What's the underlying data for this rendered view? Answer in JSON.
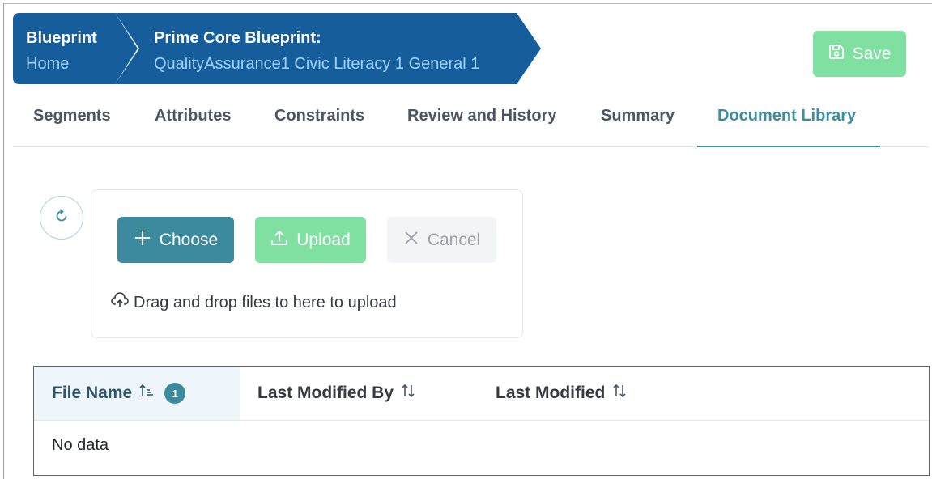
{
  "breadcrumb": {
    "first": {
      "title": "Blueprint",
      "subtitle": "Home"
    },
    "second": {
      "title": "Prime Core Blueprint:",
      "subtitle": "QualityAssurance1 Civic Literacy 1 General 1"
    },
    "color": "#165d9c"
  },
  "toolbar": {
    "save_label": "Save",
    "save_icon": "floppy-disk-icon"
  },
  "tabs": [
    {
      "label": "Segments"
    },
    {
      "label": "Attributes"
    },
    {
      "label": "Constraints"
    },
    {
      "label": "Review and History"
    },
    {
      "label": "Summary"
    },
    {
      "label": "Document Library",
      "active": true
    }
  ],
  "upload": {
    "refresh_icon": "refresh-icon",
    "choose_label": "Choose",
    "upload_label": "Upload",
    "cancel_label": "Cancel",
    "dropzone_text": "Drag and drop files to here to upload"
  },
  "table": {
    "columns": [
      {
        "label": "File Name",
        "sort": "ascending",
        "sort_badge": "1"
      },
      {
        "label": "Last Modified By",
        "sort": "none"
      },
      {
        "label": "Last Modified",
        "sort": "none"
      }
    ],
    "empty_text": "No data"
  },
  "colors": {
    "primary": "#3b8a9d",
    "success": "#7fe0a1",
    "breadcrumb": "#165d9c",
    "active_tab": "#3a8ea0"
  }
}
